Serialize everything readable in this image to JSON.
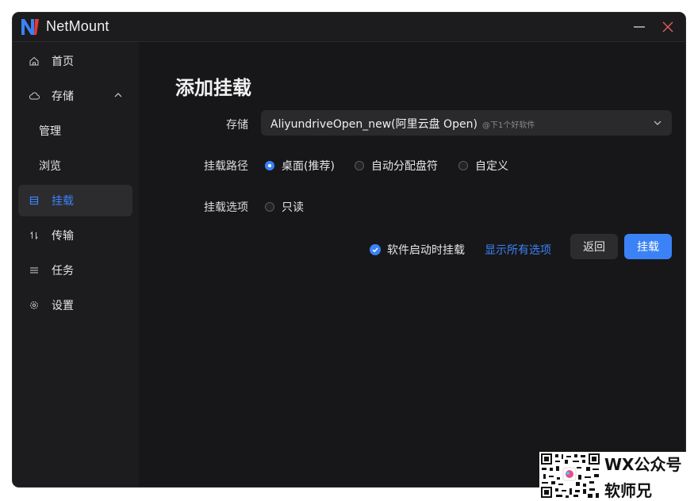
{
  "app": {
    "title": "NetMount"
  },
  "sidebar": {
    "items": [
      {
        "label": "首页",
        "icon": "home-icon"
      },
      {
        "label": "存储",
        "icon": "cloud-icon"
      },
      {
        "label": "管理"
      },
      {
        "label": "浏览"
      },
      {
        "label": "挂载",
        "icon": "mount-icon"
      },
      {
        "label": "传输",
        "icon": "transfer-icon"
      },
      {
        "label": "任务",
        "icon": "list-icon"
      },
      {
        "label": "设置",
        "icon": "gear-icon"
      }
    ]
  },
  "main": {
    "title": "添加挂载",
    "storage": {
      "label": "存储",
      "value": "AliyundriveOpen_new(阿里云盘 Open)",
      "hint": "@下1个好软件"
    },
    "mount_path": {
      "label": "挂载路径",
      "options": [
        "桌面(推荐)",
        "自动分配盘符",
        "自定义"
      ],
      "selected": "桌面(推荐)"
    },
    "mount_options": {
      "label": "挂载选项",
      "options": [
        "只读"
      ]
    },
    "autostart": {
      "label": "软件启动时挂载",
      "checked": true
    },
    "show_all_link": "显示所有选项",
    "back_button": "返回",
    "mount_button": "挂载"
  },
  "watermark": {
    "line1": "WX公众号",
    "line2": "软师兄"
  },
  "colors": {
    "accent": "#3b82f6",
    "background": "#17171a",
    "sidebar": "#1c1c1e",
    "logo_red": "#e53935"
  }
}
